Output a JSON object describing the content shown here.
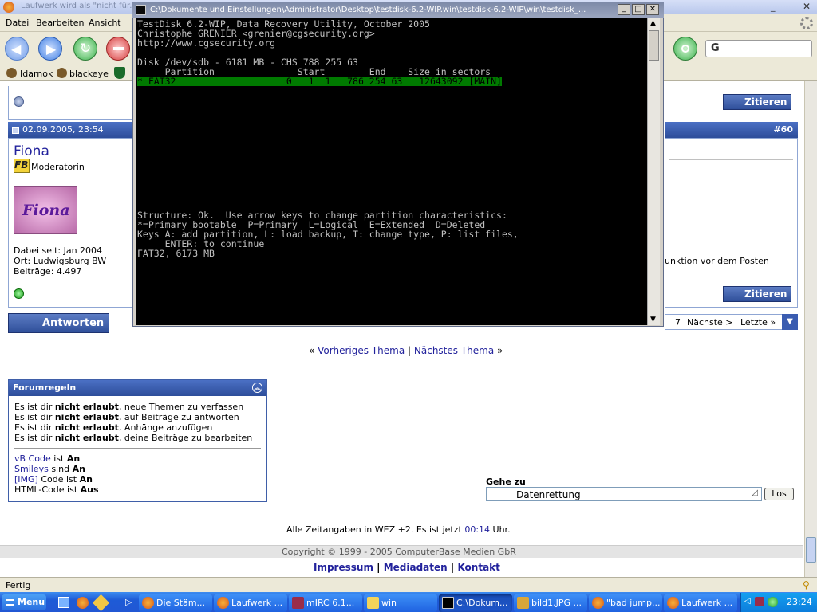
{
  "browser": {
    "title": "Laufwerk wird als \"nicht für..",
    "menu": [
      "Datei",
      "Bearbeiten",
      "Ansicht"
    ],
    "bookmarks": [
      "Idarnok",
      "blackeye"
    ],
    "search_value": "G",
    "status": "Fertig"
  },
  "post": {
    "date": "02.09.2005, 23:54",
    "number": "#60",
    "author": "Fiona",
    "role": "Moderatorin",
    "avatar_text": "Fiona",
    "joined": "Dabei seit: Jan 2004",
    "location": "Ort: Ludwigsburg BW",
    "posts": "Beiträge: 4.497",
    "quote_label": "Zitieren",
    "right_text": "unktion vor dem Posten"
  },
  "reply_label": "Antworten",
  "pagination": {
    "page": "7",
    "next": "Nächste >",
    "last": "Letzte »"
  },
  "thread_nav": {
    "prev": "Vorheriges Thema",
    "sep": "|",
    "next": "Nächstes Thema"
  },
  "rules": {
    "title": "Forumregeln",
    "lines": [
      {
        "pre": "Es ist dir ",
        "bold": "nicht erlaubt",
        "post": ", neue Themen zu verfassen"
      },
      {
        "pre": "Es ist dir ",
        "bold": "nicht erlaubt",
        "post": ", auf Beiträge zu antworten"
      },
      {
        "pre": "Es ist dir ",
        "bold": "nicht erlaubt",
        "post": ", Anhänge anzufügen"
      },
      {
        "pre": "Es ist dir ",
        "bold": "nicht erlaubt",
        "post": ", deine Beiträge zu bearbeiten"
      }
    ],
    "codes": [
      {
        "link": "vB Code",
        "mid": " ist ",
        "val": "An"
      },
      {
        "link": "Smileys",
        "mid": " sind ",
        "val": "An"
      },
      {
        "link": "[IMG]",
        "mid": " Code ist ",
        "val": "An"
      },
      {
        "link": "",
        "mid": "HTML-Code ist ",
        "val": "Aus"
      }
    ]
  },
  "goto": {
    "label": "Gehe zu",
    "value": "Datenrettung",
    "button": "Los"
  },
  "timezone": {
    "pre": "Alle Zeitangaben in WEZ +2. Es ist jetzt ",
    "time": "00:14",
    "post": " Uhr."
  },
  "copyright": "Copyright © 1999 - 2005 ComputerBase Medien GbR",
  "footer_links": [
    "Impressum",
    "Mediadaten",
    "Kontakt"
  ],
  "terminal": {
    "title": "C:\\Dokumente und Einstellungen\\Administrator\\Desktop\\testdisk-6.2-WIP.win\\testdisk-6.2-WIP\\win\\testdisk_...",
    "lines": [
      "TestDisk 6.2-WIP, Data Recovery Utility, October 2005",
      "Christophe GRENIER <grenier@cgsecurity.org>",
      "http://www.cgsecurity.org",
      "",
      "Disk /dev/sdb - 6181 MB - CHS 788 255 63",
      "     Partition               Start        End    Size in sectors"
    ],
    "highlight": "* FAT32                    0   1  1   786 254 63   12643092 [MAIN]",
    "footer_lines": [
      "Structure: Ok.  Use arrow keys to change partition characteristics:",
      "*=Primary bootable  P=Primary  L=Logical  E=Extended  D=Deleted",
      "Keys A: add partition, L: load backup, T: change type, P: list files,",
      "     ENTER: to continue",
      "FAT32, 6173 MB"
    ]
  },
  "taskbar": {
    "start": "Menu",
    "tasks": [
      "Die Stäm...",
      "Laufwerk ...",
      "mIRC 6.1...",
      "win",
      "C:\\Dokum...",
      "bild1.JPG ...",
      "\"bad jump...",
      "Laufwerk ..."
    ],
    "clock": "23:24"
  },
  "colors": {
    "forum_blue": "#3a5cb0",
    "terminal_highlight": "#007a00",
    "taskbar": "#2157d4"
  }
}
